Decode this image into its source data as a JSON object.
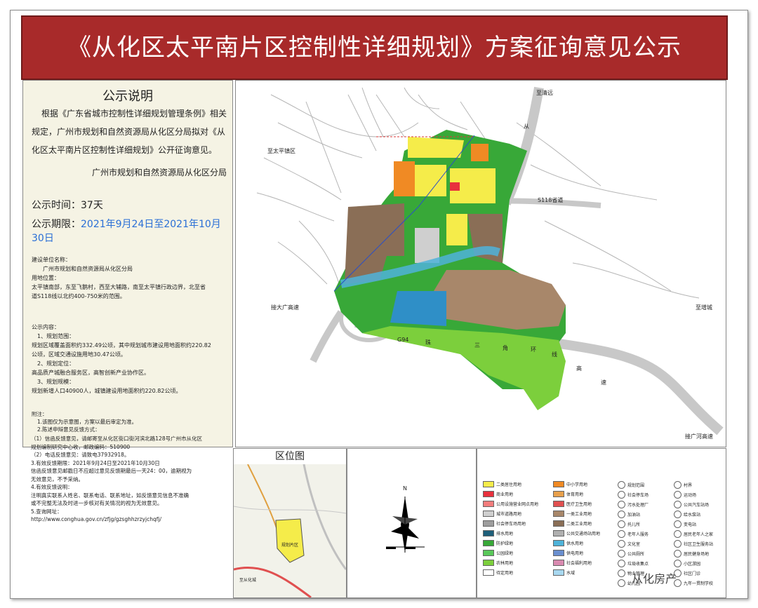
{
  "title": "《从化区太平南片区控制性详细规划》方案征询意见公示",
  "notice": {
    "heading": "公示说明",
    "para_lines": [
      "根据《广东省城市控制性详细规划管理条例》相关",
      "规定，广州市规划和自然资源局从化区分局拟对《从",
      "化区太平南片区控制性详细规划》公开征询意见。"
    ],
    "signature": "广州市规划和自然资源局从化区分局",
    "duration_label": "公示时间：37天",
    "period_label": "公示期限：",
    "period_value": "2021年9月24日至2021年10月30日",
    "small_block1": [
      "建设单位名称：",
      "广州市规划和自然资源局从化区分局",
      "用地位置：",
      "太平镇南部，东至飞鹅村，西至大辅路，南至太平镇行政边界，北至省",
      "道S118线以北约400-750米的范围。"
    ],
    "small_block2": [
      "公示内容：",
      "1、规划范围：",
      "规划区域覆盖面积约332.49公顷，其中规划城市建设用地面积约220.82",
      "公顷，区域交通设施用地30.47公顷。",
      "2、规划定位：",
      "高品质产城融合服务区，高智创新产业协作区。",
      "3、规划规模：",
      "规划新增人口40900人，城镇建设用地面积约220.82公顷。"
    ],
    "small_block3": [
      "附注：",
      "1.该图仅为示意图，方案以最后审定为准。",
      "2.陈述申辩意见反馈方式：",
      "（1）信函反馈意见，请邮寄至从化区街口街河滨北路128号广州市从化区",
      "规划编制研究中心收，邮政编码：510900",
      "（2）电话反馈意见：请致电37932918。",
      "3.有效反馈期限：2021年9月24日至2021年10月30日",
      "信函反馈意见邮戳日不应超过意见反馈期最后一天24：00，逾期视为",
      "无效意见，不予采纳。",
      "4.有效反馈说明：",
      "注明真实联系人姓名、联系电话、联系地址，如反馈意见信息不准确",
      "或不完整无法及时进一步核对有关情况的视为无效意见。",
      "5.查询网址：",
      "http://www.conghua.gov.cn/zfjg/gzsghhzrzyjchqfj/"
    ]
  },
  "map": {
    "labels": {
      "qingyuan": "至清远",
      "taipingzhen": "至太平镇区",
      "cong": "从",
      "road_s118": "S118省道",
      "da_guang": "接大广高速",
      "zengcheng": "至增城",
      "g94": "G94",
      "zhu": "珠",
      "san": "三",
      "jiao": "角",
      "huan": "环",
      "xian": "线",
      "gao": "高",
      "su": "速",
      "guanghe": "接广河高速"
    }
  },
  "location": {
    "title": "区位图",
    "area_label": "规划片区",
    "town_label": "至从化城"
  },
  "compass": {
    "n": "N"
  },
  "legend": {
    "items": [
      {
        "label": "二类居住用地",
        "color": "#f5ec4a"
      },
      {
        "label": "商业用地",
        "color": "#e8313d"
      },
      {
        "label": "公用设施营业网点用地",
        "color": "#f27c7c"
      },
      {
        "label": "城市道路用地",
        "color": "#cfcfcf"
      },
      {
        "label": "社会停车场用地",
        "color": "#9d9d9d"
      },
      {
        "label": "排水用地",
        "color": "#1e5f7a"
      },
      {
        "label": "防护绿地",
        "color": "#38a838"
      },
      {
        "label": "公园绿地",
        "color": "#5ac85a"
      },
      {
        "label": "农林用地",
        "color": "#7ccf3c"
      },
      {
        "label": "待定用地",
        "color": "#ffffff"
      },
      {
        "label": "中小学用地",
        "color": "#f08a24"
      },
      {
        "label": "体育用地",
        "color": "#e8a04c"
      },
      {
        "label": "医疗卫生用地",
        "color": "#e05050"
      },
      {
        "label": "一类工业用地",
        "color": "#a8876a"
      },
      {
        "label": "二类工业用地",
        "color": "#8a6e56"
      },
      {
        "label": "公共交通场站用地",
        "color": "#b0b0b0"
      },
      {
        "label": "供水用地",
        "color": "#4fb3d9"
      },
      {
        "label": "供电用地",
        "color": "#6a8fcf"
      },
      {
        "label": "社会福利用地",
        "color": "#d98ab0"
      },
      {
        "label": "水域",
        "color": "#a8d8f0"
      },
      {
        "label": "规划范围",
        "color": "#ffffff"
      },
      {
        "label": "社会停车场",
        "color": "#ffffff"
      },
      {
        "label": "污水处理厂",
        "color": "#ffffff"
      },
      {
        "label": "加油站",
        "color": "#ffffff"
      },
      {
        "label": "托儿所",
        "color": "#ffffff"
      },
      {
        "label": "老年人服务",
        "color": "#ffffff"
      },
      {
        "label": "文化室",
        "color": "#ffffff"
      },
      {
        "label": "公共厕所",
        "color": "#ffffff"
      },
      {
        "label": "垃圾收集点",
        "color": "#ffffff"
      },
      {
        "label": "物业管理",
        "color": "#ffffff"
      },
      {
        "label": "幼儿园",
        "color": "#ffffff"
      },
      {
        "label": "村界",
        "color": "#ffffff"
      },
      {
        "label": "运动场",
        "color": "#ffffff"
      },
      {
        "label": "公共汽车站场",
        "color": "#ffffff"
      },
      {
        "label": "给水泵站",
        "color": "#ffffff"
      },
      {
        "label": "变电站",
        "color": "#ffffff"
      },
      {
        "label": "居民老年人之家",
        "color": "#ffffff"
      },
      {
        "label": "社区卫生服务站",
        "color": "#ffffff"
      },
      {
        "label": "居民健身场地",
        "color": "#ffffff"
      },
      {
        "label": "小区游园",
        "color": "#ffffff"
      },
      {
        "label": "社区门诊",
        "color": "#ffffff"
      },
      {
        "label": "九年一贯制学校",
        "color": "#ffffff"
      }
    ]
  },
  "watermark": "从化房产"
}
